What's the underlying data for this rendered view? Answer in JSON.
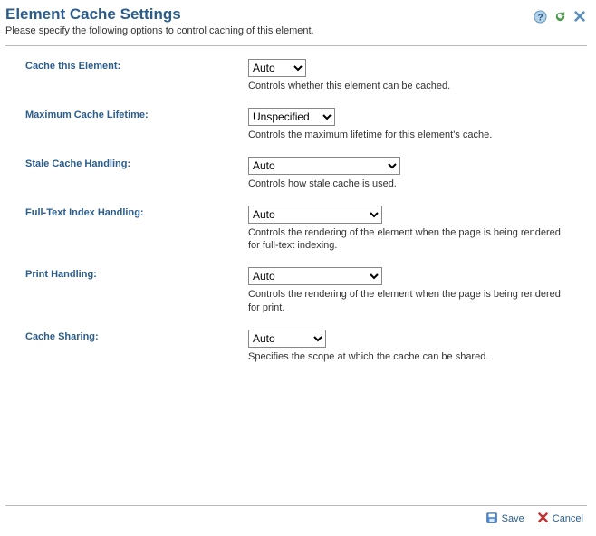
{
  "header": {
    "title": "Element Cache Settings",
    "subtitle": "Please specify the following options to control caching of this element."
  },
  "fields": {
    "cache_this": {
      "label": "Cache this Element:",
      "value": "Auto",
      "desc": "Controls whether this element can be cached."
    },
    "max_lifetime": {
      "label": "Maximum Cache Lifetime:",
      "value": "Unspecified",
      "desc": "Controls the maximum lifetime for this element's cache."
    },
    "stale": {
      "label": "Stale Cache Handling:",
      "value": "Auto",
      "desc": "Controls how stale cache is used."
    },
    "fulltext": {
      "label": "Full-Text Index Handling:",
      "value": "Auto",
      "desc": "Controls the rendering of the element when the page is being rendered for full-text indexing."
    },
    "print": {
      "label": "Print Handling:",
      "value": "Auto",
      "desc": "Controls the rendering of the element when the page is being rendered for print."
    },
    "sharing": {
      "label": "Cache Sharing:",
      "value": "Auto",
      "desc": "Specifies the scope at which the cache can be shared."
    }
  },
  "footer": {
    "save": "Save",
    "cancel": "Cancel"
  }
}
